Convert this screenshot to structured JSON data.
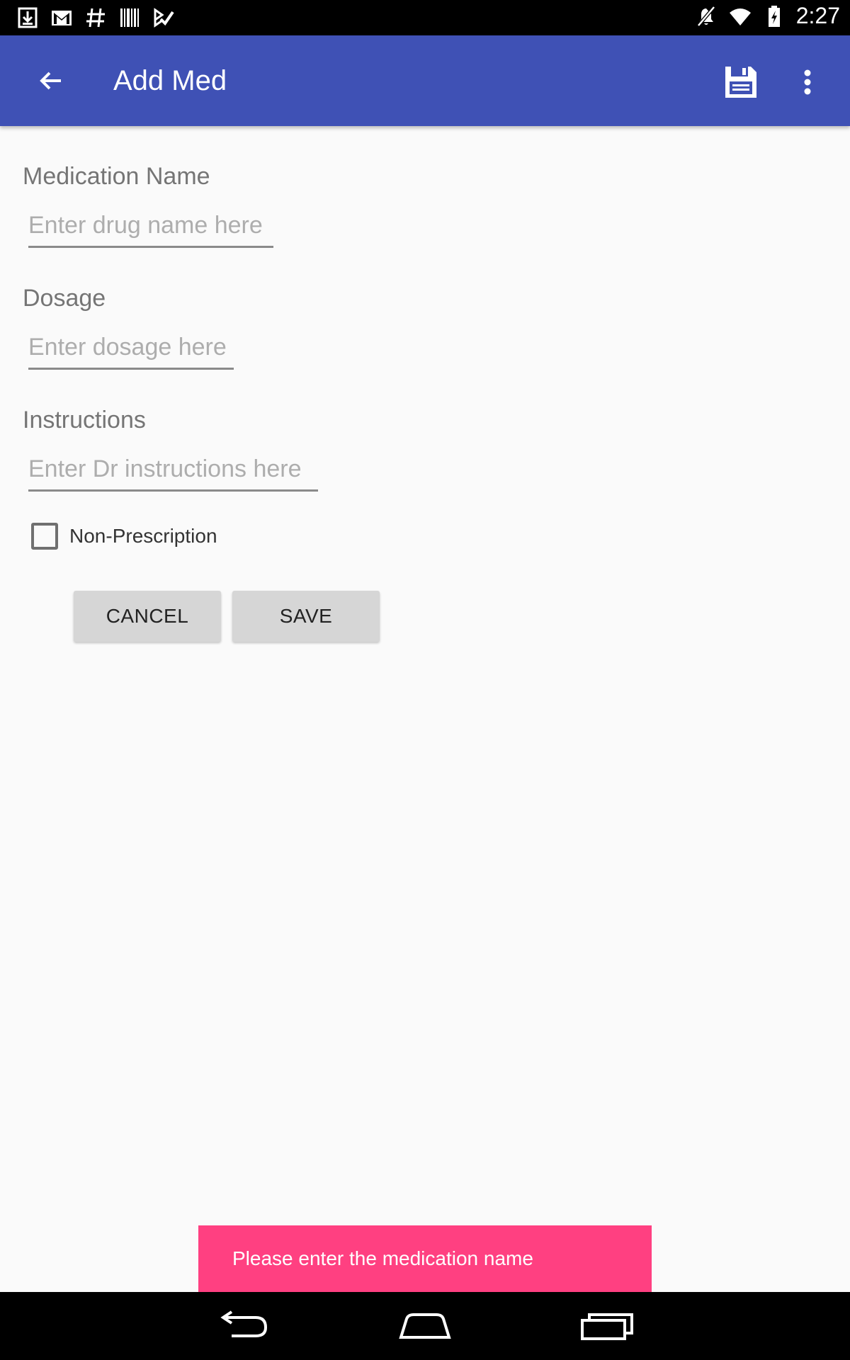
{
  "status_bar": {
    "time": "2:27",
    "left_icons": [
      "download-icon",
      "gmail-icon",
      "hashtag-icon",
      "barcode-icon",
      "tasks-icon"
    ],
    "right_icons": [
      "mute-icon",
      "wifi-icon",
      "battery-charging-icon"
    ]
  },
  "app_bar": {
    "title": "Add Med",
    "color": "#3f51b5",
    "actions": [
      "save-icon",
      "more-vert-icon"
    ]
  },
  "form": {
    "medication_name": {
      "label": "Medication Name",
      "placeholder": "Enter drug name here",
      "value": ""
    },
    "dosage": {
      "label": "Dosage",
      "placeholder": "Enter dosage here",
      "value": ""
    },
    "instructions": {
      "label": "Instructions",
      "placeholder": "Enter Dr instructions here",
      "value": ""
    },
    "non_prescription": {
      "label": "Non-Prescription",
      "checked": false
    },
    "cancel_label": "CANCEL",
    "save_label": "SAVE"
  },
  "toast": {
    "message": "Please enter the medication name",
    "color": "#ff4081"
  },
  "nav_bar": {
    "buttons": [
      "back-icon",
      "home-icon",
      "recents-icon"
    ]
  }
}
